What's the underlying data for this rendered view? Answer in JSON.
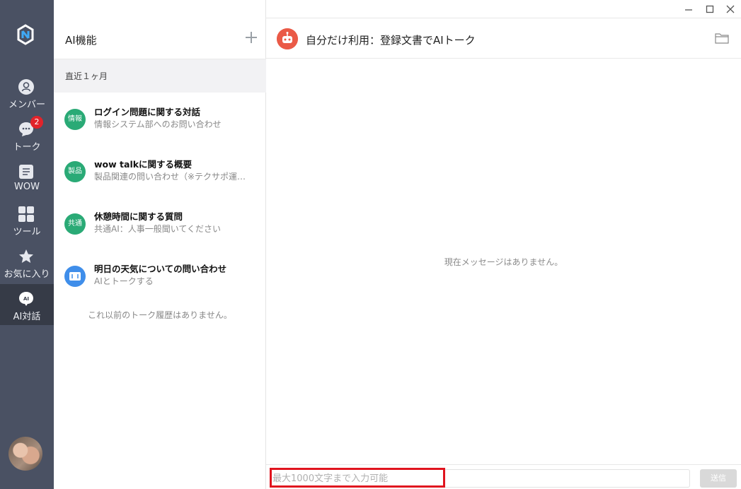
{
  "sidebar": {
    "items": [
      {
        "label": "メンバー",
        "icon": "person-icon"
      },
      {
        "label": "トーク",
        "icon": "chat-icon",
        "badge": "2"
      },
      {
        "label": "WOW",
        "icon": "list-icon"
      },
      {
        "label": "ツール",
        "icon": "grid-icon"
      },
      {
        "label": "お気に入り",
        "icon": "star-icon"
      },
      {
        "label": "AI対話",
        "icon": "ai-icon"
      }
    ],
    "accent": "#4a5163",
    "active_bg": "#363b47"
  },
  "list_panel": {
    "title": "AI機能",
    "section": "直近１ヶ月",
    "conversations": [
      {
        "badge": "情報",
        "title": "ログイン問題に関する対話",
        "subtitle": "情報システム部へのお問い合わせ"
      },
      {
        "badge": "製品",
        "title": "wow talkに関する概要",
        "subtitle": "製品関連の問い合わせ（※テクサポ運…"
      },
      {
        "badge": "共通",
        "title": "休憩時間に関する質問",
        "subtitle": "共通AI：人事一般聞いてください"
      },
      {
        "badge": "",
        "title": "明日の天気についての問い合わせ",
        "subtitle": "AIとトークする"
      }
    ],
    "no_history": "これ以前のトーク履歴はありません。"
  },
  "chat": {
    "title": "自分だけ利用：登録文書でAIトーク",
    "empty_message": "現在メッセージはありません。",
    "input_placeholder": "最大1000文字まで入力可能",
    "send_label": "送信"
  },
  "colors": {
    "green": "#2aaa76",
    "blue": "#3f8eea",
    "bot": "#ea5a47",
    "badge_red": "#e2232a",
    "highlight": "#e0141e"
  }
}
